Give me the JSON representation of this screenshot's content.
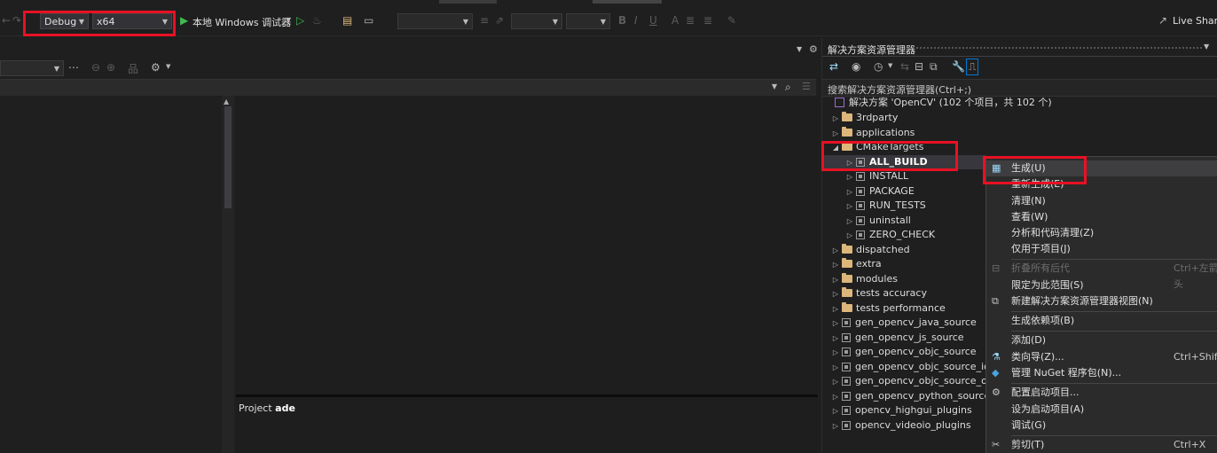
{
  "toolbar": {
    "config": "Debug",
    "platform": "x64",
    "run_label": "本地 Windows 调试器",
    "live_share": "Live Share"
  },
  "editor": {
    "output_prefix": "Project",
    "output_project": "ade"
  },
  "solution_explorer": {
    "title": "解决方案资源管理器",
    "search_placeholder": "搜索解决方案资源管理器(Ctrl+;)",
    "solution_label": "解决方案 'OpenCV' (102 个项目，共 102 个)",
    "nodes": [
      "3rdparty",
      "applications",
      "CMakeTargets",
      "ALL_BUILD",
      "INSTALL",
      "PACKAGE",
      "RUN_TESTS",
      "uninstall",
      "ZERO_CHECK",
      "dispatched",
      "extra",
      "modules",
      "tests accuracy",
      "tests performance",
      "gen_opencv_java_source",
      "gen_opencv_js_source",
      "gen_opencv_objc_source",
      "gen_opencv_objc_source_ios",
      "gen_opencv_objc_source_osx",
      "gen_opencv_python_source",
      "opencv_highgui_plugins",
      "opencv_videoio_plugins"
    ]
  },
  "context_menu": {
    "items": [
      {
        "label": "生成(U)",
        "shortcut": ""
      },
      {
        "label": "重新生成(E)",
        "shortcut": ""
      },
      {
        "label": "清理(N)",
        "shortcut": ""
      },
      {
        "label": "查看(W)",
        "shortcut": ""
      },
      {
        "label": "分析和代码清理(Z)",
        "shortcut": ""
      },
      {
        "label": "仅用于项目(J)",
        "shortcut": ""
      },
      {
        "label": "折叠所有后代",
        "shortcut": "Ctrl+左箭头"
      },
      {
        "label": "限定为此范围(S)",
        "shortcut": ""
      },
      {
        "label": "新建解决方案资源管理器视图(N)",
        "shortcut": ""
      },
      {
        "label": "生成依赖项(B)",
        "shortcut": ""
      },
      {
        "label": "添加(D)",
        "shortcut": ""
      },
      {
        "label": "类向导(Z)...",
        "shortcut": "Ctrl+Shift+X"
      },
      {
        "label": "管理 NuGet 程序包(N)...",
        "shortcut": ""
      },
      {
        "label": "配置启动项目...",
        "shortcut": ""
      },
      {
        "label": "设为启动项目(A)",
        "shortcut": ""
      },
      {
        "label": "调试(G)",
        "shortcut": ""
      },
      {
        "label": "剪切(T)",
        "shortcut": "Ctrl+X"
      }
    ]
  }
}
